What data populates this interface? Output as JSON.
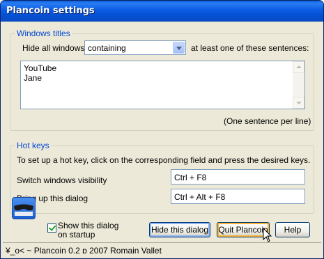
{
  "window": {
    "title": "Plancoin settings"
  },
  "windows_titles": {
    "legend": "Windows titles",
    "hide_label": "Hide all windows",
    "mode_selected": "containing",
    "suffix_label": "at least one of these sentences:",
    "sentences": [
      "YouTube",
      "Jane"
    ],
    "hint": "(One sentence per line)"
  },
  "hot_keys": {
    "legend": "Hot keys",
    "instructions": "To set up a hot key, click on the corresponding field and press the desired keys.",
    "switch_label": "Switch windows visibility",
    "switch_value": "Ctrl + F8",
    "bring_label": "Bring up this dialog",
    "bring_value": "Ctrl + Alt + F8"
  },
  "footer": {
    "show_dialog_label_line1": "Show this dialog",
    "show_dialog_label_line2": "on startup",
    "show_dialog_checked": true,
    "hide_button": "Hide this dialog",
    "quit_button": "Quit Plancoin",
    "help_button": "Help"
  },
  "status": {
    "text": "¥_o< ~ Plancoin 0.2 ɒ 2007 Romain Vallet"
  },
  "icons": {
    "logo": "sunglasses-logo-icon",
    "cursor": "mouse-pointer-icon"
  }
}
